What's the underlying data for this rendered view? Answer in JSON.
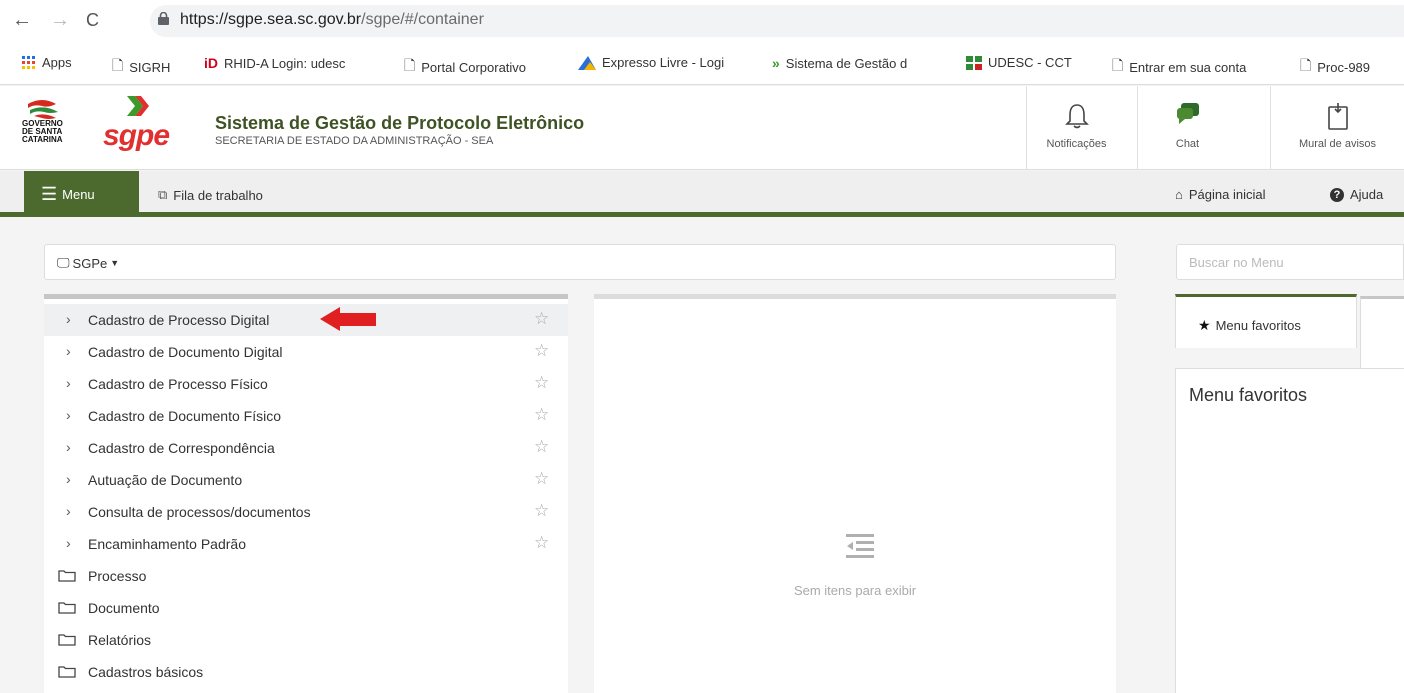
{
  "browser": {
    "url_host": "https://sgpe.sea.sc.gov.br",
    "url_path": "/sgpe/#/container",
    "bookmarks": [
      {
        "label": "Apps",
        "icon": "apps-grid-icon"
      },
      {
        "label": "SIGRH",
        "icon": "page-icon"
      },
      {
        "label": "RHID-A Login: udesc",
        "icon": "id-logo-icon"
      },
      {
        "label": "Portal Corporativo",
        "icon": "page-icon"
      },
      {
        "label": "Expresso Livre - Logi",
        "icon": "expresso-icon"
      },
      {
        "label": "Sistema de Gestão d",
        "icon": "sgpe-chevron-icon"
      },
      {
        "label": "UDESC - CCT",
        "icon": "udesc-icon"
      },
      {
        "label": "Entrar em sua conta",
        "icon": "page-icon"
      },
      {
        "label": "Proc-989",
        "icon": "page-icon"
      }
    ]
  },
  "header": {
    "gov_logo_text": "GOVERNO\nDE SANTA\nCATARINA",
    "sgpe_logo_text": "sgpe",
    "title": "Sistema de Gestão de Protocolo Eletrônico",
    "subtitle": "SECRETARIA DE ESTADO DA ADMINISTRAÇÃO - SEA",
    "buttons": [
      {
        "label": "Notificações",
        "icon": "bell-icon"
      },
      {
        "label": "Chat",
        "icon": "chat-icon"
      },
      {
        "label": "Mural de avisos",
        "icon": "notice-board-icon"
      }
    ]
  },
  "navbar": {
    "menu_label": "Menu",
    "queue_label": "Fila de trabalho",
    "home_label": "Página inicial",
    "help_label": "Ajuda",
    "accent": "#4c6a2e"
  },
  "system_select": {
    "value": "SGPe"
  },
  "search": {
    "placeholder": "Buscar no Menu"
  },
  "menu": {
    "items": [
      {
        "label": "Cadastro de Processo Digital"
      },
      {
        "label": "Cadastro de Documento Digital"
      },
      {
        "label": "Cadastro de Processo Físico"
      },
      {
        "label": "Cadastro de Documento Físico"
      },
      {
        "label": "Cadastro de Correspondência"
      },
      {
        "label": "Autuação de Documento"
      },
      {
        "label": "Consulta de processos/documentos"
      },
      {
        "label": "Encaminhamento Padrão"
      }
    ],
    "folders": [
      {
        "label": "Processo"
      },
      {
        "label": "Documento"
      },
      {
        "label": "Relatórios"
      },
      {
        "label": "Cadastros básicos"
      }
    ]
  },
  "center": {
    "empty_text": "Sem itens para exibir"
  },
  "favorites": {
    "tab_label": "Menu favoritos",
    "panel_title": "Menu favoritos"
  },
  "annotation": {
    "arrow_color": "#e02020"
  }
}
